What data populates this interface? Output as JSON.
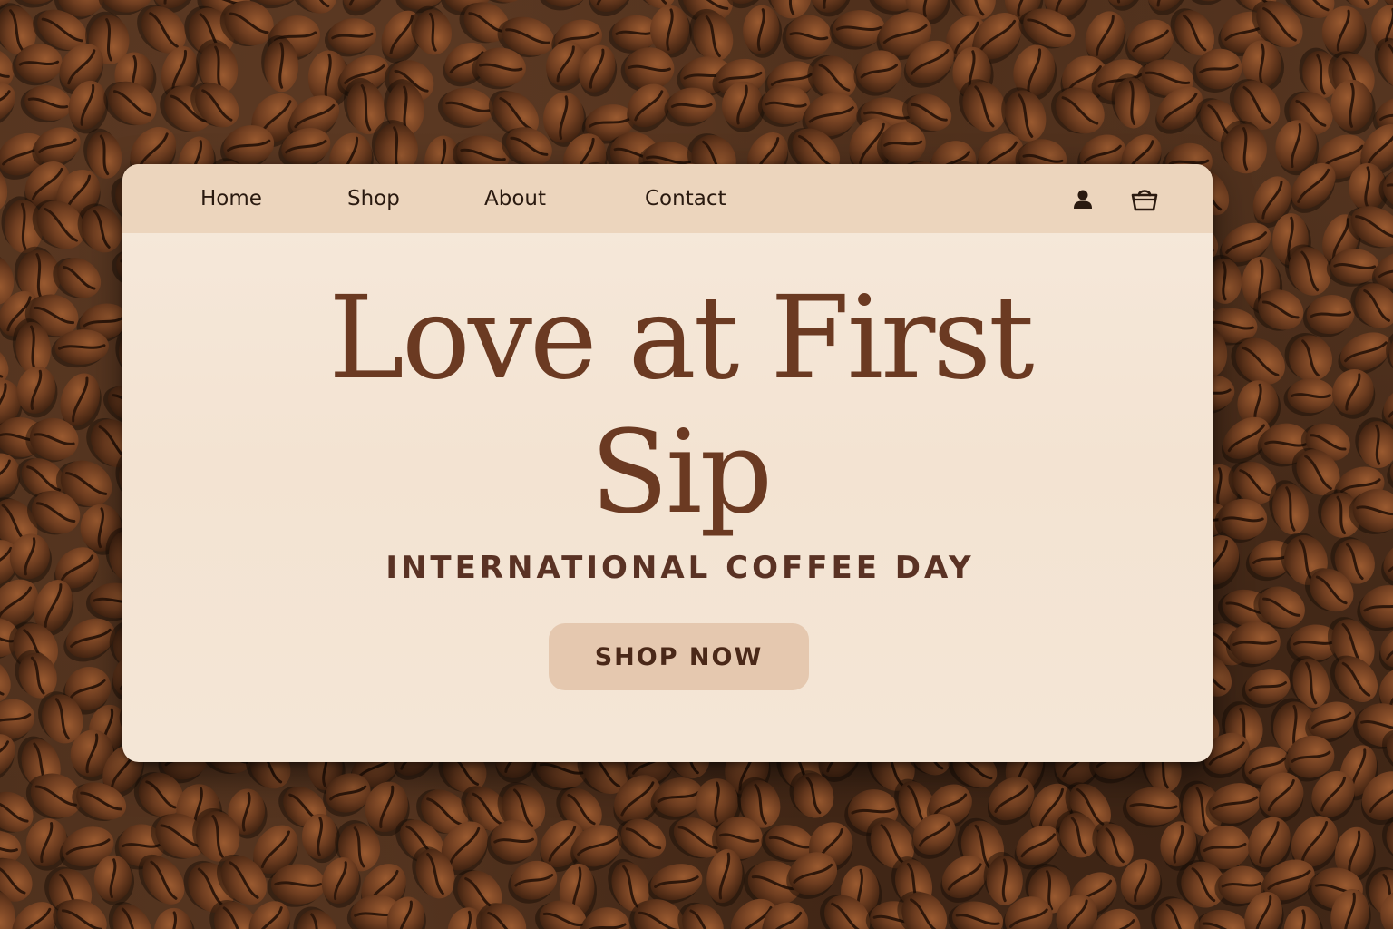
{
  "nav": {
    "links": [
      "Home",
      "Shop",
      "About",
      "Contact"
    ],
    "icons": {
      "account": "user-icon",
      "cart": "shopping-basket-icon"
    }
  },
  "hero": {
    "headline_line1": "Love at First",
    "headline_line2": "Sip",
    "subheading": "INTERNATIONAL COFFEE DAY",
    "cta_label": "SHOP NOW"
  },
  "colors": {
    "card_background": "#f4e6d6",
    "navbar_background": "#ecd5bd",
    "headline": "#6b3a22",
    "subheading": "#5a3224",
    "button_background": "#e5c8af",
    "button_text": "#4a2818",
    "coffee_bean": "#6e3d20",
    "wood_background": "#4f311d"
  }
}
